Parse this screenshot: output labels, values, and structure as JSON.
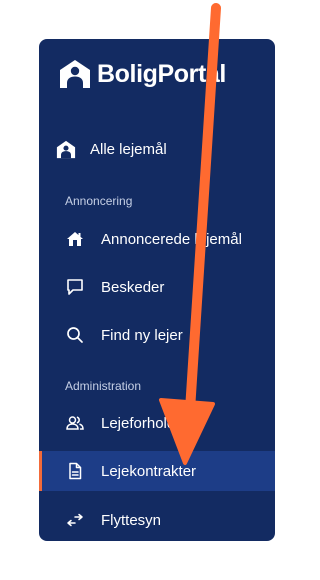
{
  "brand": {
    "name": "BoligPortal"
  },
  "nav": {
    "all_leases": "Alle lejemål",
    "section_advertising": "Annoncering",
    "advertised": "Annoncerede lejemål",
    "messages": "Beskeder",
    "find_tenant": "Find ny lejer",
    "section_admin": "Administration",
    "tenancies": "Lejeforhold",
    "contracts": "Lejekontrakter",
    "moving_inspection": "Flyttesyn"
  },
  "colors": {
    "panel": "#132b62",
    "active_row": "#1d3d87",
    "active_marker": "#f26b3a",
    "annotation_arrow": "#ff6a30"
  },
  "icons": {
    "brand": "house-person-icon",
    "all_leases": "house-person-icon",
    "advertised": "house-icon",
    "messages": "chat-bubble-icon",
    "find_tenant": "search-icon",
    "tenancies": "people-icon",
    "contracts": "document-icon",
    "moving_inspection": "swap-arrows-icon"
  }
}
